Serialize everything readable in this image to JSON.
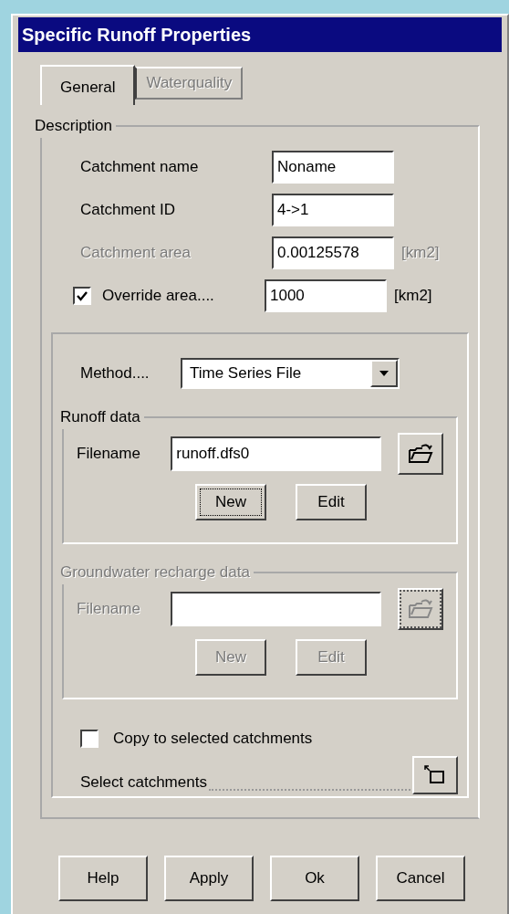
{
  "window": {
    "title": "Specific Runoff Properties"
  },
  "tabs": [
    {
      "label": "General",
      "selected": true,
      "disabled": false
    },
    {
      "label": "Waterquality",
      "selected": false,
      "disabled": true
    }
  ],
  "description": {
    "legend": "Description",
    "fields": [
      {
        "label": "Catchment name",
        "value": "Noname",
        "disabled": false
      },
      {
        "label": "Catchment ID",
        "value": "4->1",
        "disabled": false
      },
      {
        "label": "Catchment area",
        "value": "0.00125578",
        "unit": "[km2]",
        "disabled": true
      }
    ],
    "override": {
      "label": "Override area....",
      "checked": true,
      "value": "1000",
      "unit": "[km2]"
    }
  },
  "method": {
    "label": "Method....",
    "value": "Time Series File"
  },
  "groups": [
    {
      "legend": "Runoff data",
      "disabled": false,
      "filename_label": "Filename",
      "filename": "runoff.dfs0",
      "browse_focused": false,
      "buttons": [
        {
          "label": "New",
          "focused": true
        },
        {
          "label": "Edit",
          "focused": false
        }
      ]
    },
    {
      "legend": "Groundwater recharge data",
      "disabled": true,
      "filename_label": "Filename",
      "browse_focused": true,
      "buttons": [
        {
          "label": "New",
          "focused": false
        },
        {
          "label": "Edit",
          "focused": false
        }
      ]
    }
  ],
  "copy": {
    "label": "Copy to selected catchments",
    "checked": false
  },
  "select": {
    "label": "Select catchments"
  },
  "buttons": [
    {
      "label": "Help"
    },
    {
      "label": "Apply"
    },
    {
      "label": "Ok"
    },
    {
      "label": "Cancel"
    }
  ]
}
